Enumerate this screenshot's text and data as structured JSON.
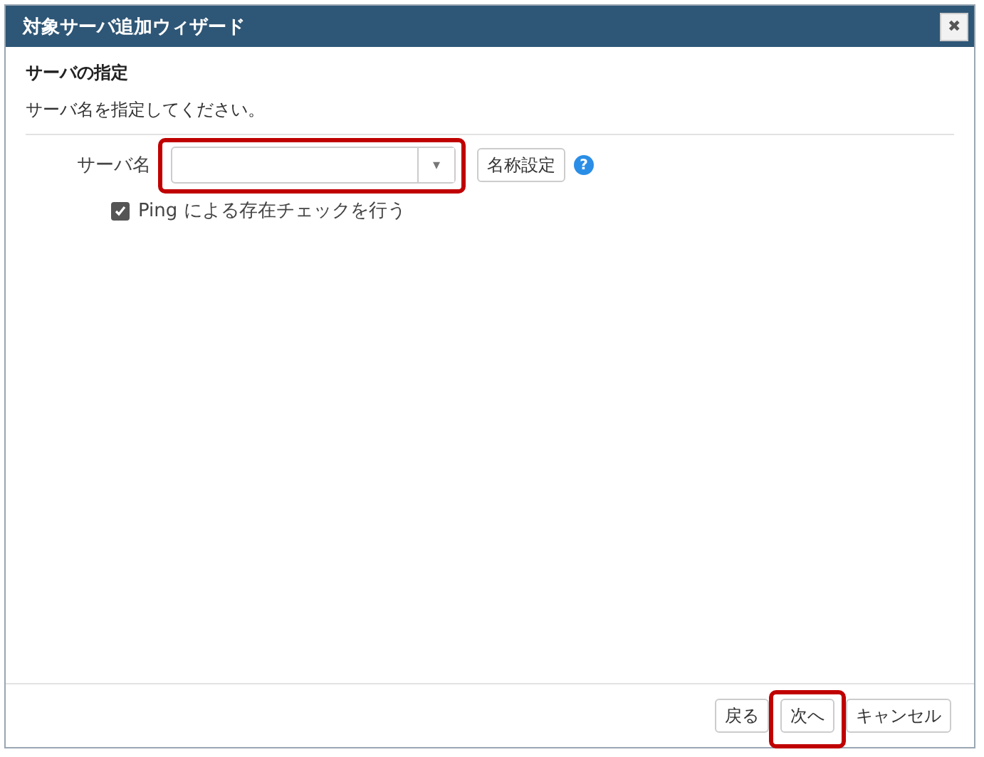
{
  "window": {
    "title": "対象サーバ追加ウィザード",
    "close": "✖"
  },
  "section": {
    "heading": "サーバの指定",
    "description": "サーバ名を指定してください。"
  },
  "server_name": {
    "label": "サーバ名",
    "highlighted": true,
    "caret": "▾",
    "name_button": "名称設定",
    "help": "?"
  },
  "ping_check": {
    "label": "Ping による存在チェックを行う",
    "checked": true
  },
  "buttons": [
    {
      "label": "戻る",
      "highlighted": false
    },
    {
      "label": "次へ",
      "highlighted": true
    },
    {
      "label": "キャンセル",
      "highlighted": false
    }
  ]
}
